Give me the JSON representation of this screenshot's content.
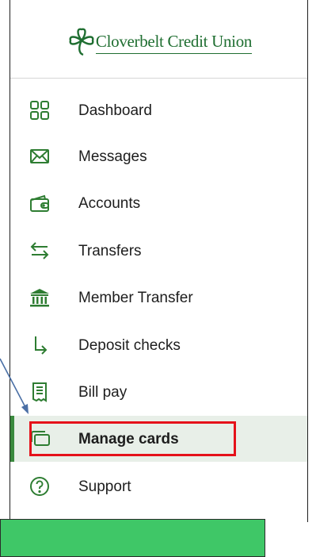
{
  "brand": {
    "name": "Cloverbelt Credit Union",
    "color": "#1f6e31"
  },
  "accent_color": "#3a8a3e",
  "highlight_color": "#e5111a",
  "callout_color": "#3fc767",
  "nav": {
    "items": [
      {
        "id": "dashboard",
        "label": "Dashboard",
        "icon": "dashboard-grid-icon",
        "active": false
      },
      {
        "id": "messages",
        "label": "Messages",
        "icon": "envelope-icon",
        "active": false
      },
      {
        "id": "accounts",
        "label": "Accounts",
        "icon": "wallet-icon",
        "active": false
      },
      {
        "id": "transfers",
        "label": "Transfers",
        "icon": "swap-arrows-icon",
        "active": false
      },
      {
        "id": "member-transfer",
        "label": "Member Transfer",
        "icon": "bank-icon",
        "active": false
      },
      {
        "id": "deposit-checks",
        "label": "Deposit checks",
        "icon": "deposit-arrow-icon",
        "active": false
      },
      {
        "id": "bill-pay",
        "label": "Bill pay",
        "icon": "receipt-icon",
        "active": false
      },
      {
        "id": "manage-cards",
        "label": "Manage cards",
        "icon": "cards-icon",
        "active": true
      },
      {
        "id": "support",
        "label": "Support",
        "icon": "help-circle-icon",
        "active": false
      }
    ]
  }
}
